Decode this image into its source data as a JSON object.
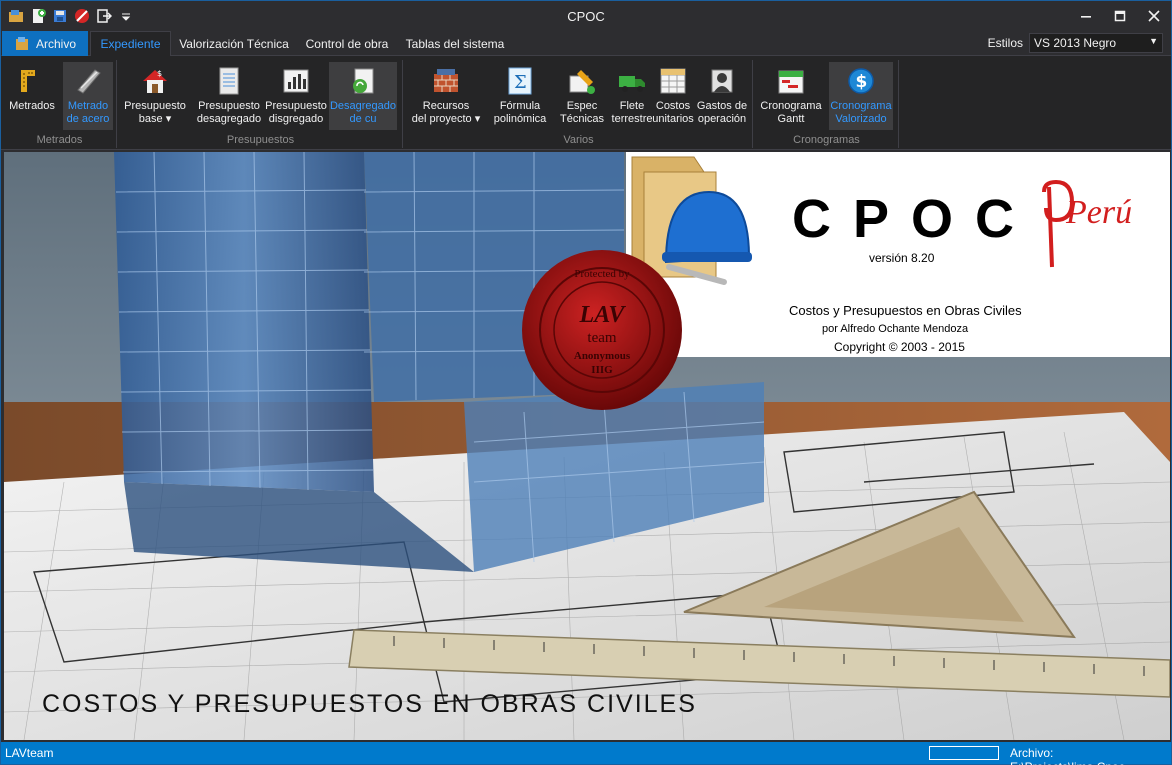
{
  "window": {
    "title": "CPOC"
  },
  "quick_access": [
    "open-icon",
    "new-icon",
    "save-icon",
    "cancel-icon",
    "exit-icon",
    "customize-arrow-icon"
  ],
  "tabs": {
    "file": "Archivo",
    "expediente": "Expediente",
    "valorizacion": "Valorización Técnica",
    "control": "Control de obra",
    "tablas": "Tablas del sistema"
  },
  "styles": {
    "label": "Estilos",
    "value": "VS 2013 Negro"
  },
  "ribbon": {
    "groups": {
      "metrados": "Metrados",
      "presupuestos": "Presupuestos",
      "varios": "Varios",
      "cronogramas": "Cronogramas"
    },
    "buttons": {
      "metrados": "Metrados",
      "metrado_acero_1": "Metrado",
      "metrado_acero_2": "de acero",
      "presupuesto_base_1": "Presupuesto",
      "presupuesto_base_2": "base ▾",
      "presupuesto_desagregado_1": "Presupuesto",
      "presupuesto_desagregado_2": "desagregado",
      "presupuesto_disgregado_1": "Presupuesto",
      "presupuesto_disgregado_2": "disgregado",
      "desagregado_cu_1": "Desagregado",
      "desagregado_cu_2": "de cu",
      "recursos_1": "Recursos",
      "recursos_2": "del proyecto ▾",
      "formula_1": "Fórmula",
      "formula_2": "polinómica",
      "espec_1": "Espec",
      "espec_2": "Técnicas",
      "flete_1": "Flete",
      "flete_2": "terrestre",
      "costos_1": "Costos",
      "costos_2": "unitarios",
      "gastos_1": "Gastos de",
      "gastos_2": "operación",
      "gantt_1": "Cronograma",
      "gantt_2": "Gantt",
      "valorizado_1": "Cronograma",
      "valorizado_2": "Valorizado"
    }
  },
  "splash": {
    "title": "CPOC",
    "brand": "Perú",
    "version": "versión 8.20",
    "subtitle": "Costos y Presupuestos en Obras Civiles",
    "author": "por Alfredo Ochante Mendoza",
    "copyright": "Copyright © 2003 - 2015",
    "banner": "COSTOS Y PRESUPUESTOS EN OBRAS CIVILES",
    "seal_lines": [
      "LAV",
      "team",
      "Anonymous",
      "IIIG"
    ],
    "seal_ring": "Protected by"
  },
  "status": {
    "left": "LAVteam",
    "right": "Archivo:  E:\\Projects\\lima.Cpoc"
  }
}
